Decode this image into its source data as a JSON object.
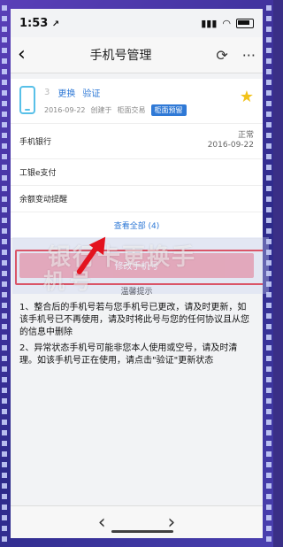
{
  "status": {
    "time": "1:53",
    "location_arrow": "↗"
  },
  "nav": {
    "back_icon": "‹",
    "title": "手机号管理",
    "refresh_icon": "⟳",
    "more_icon": "···"
  },
  "card": {
    "masked_number": "3",
    "actions": {
      "change": "更换",
      "verify": "验证"
    },
    "meta": {
      "date": "2016-09-22",
      "created_at": "创建于",
      "counter": "柜面交易",
      "badge": "柜面预留"
    },
    "star": "★"
  },
  "services": [
    {
      "label": "手机银行",
      "status": "正常",
      "date": "2016-09-22"
    },
    {
      "label": "工银e支付",
      "status": "",
      "date": ""
    },
    {
      "label": "余额变动提醒",
      "status": "",
      "date": ""
    }
  ],
  "view_all": "查看全部 (4)",
  "modify_button": "修改手机号",
  "watermark": {
    "line1": "银行卡更换手",
    "line2": "机号"
  },
  "hint": {
    "title": "温馨提示",
    "p1": "1、整合后的手机号若与您手机号已更改，请及时更新，如该手机号已不再使用，请及时将此号与您的任何协议且从您的信息中删除",
    "p2": "2、异常状态手机号可能非您本人使用或空号，请及时清理。如该手机号正在使用，请点击\"验证\"更新状态"
  },
  "bottom": {
    "back_icon": "‹",
    "forward_icon": "›"
  }
}
